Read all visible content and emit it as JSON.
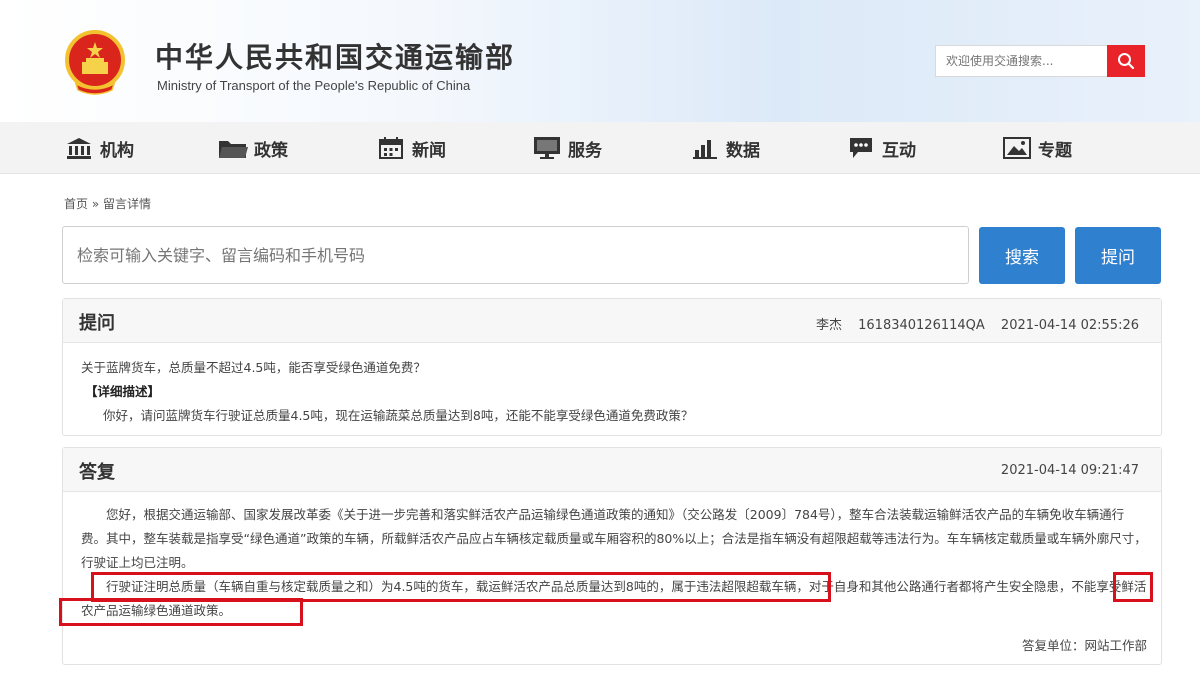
{
  "header": {
    "site_name_cn": "中华人民共和国交通运输部",
    "site_name_en": "Ministry of Transport of the People's Republic of China",
    "search_placeholder": "欢迎使用交通搜索..."
  },
  "nav": {
    "items": [
      {
        "label": "机构",
        "icon": "building-icon"
      },
      {
        "label": "政策",
        "icon": "folder-icon"
      },
      {
        "label": "新闻",
        "icon": "calendar-icon"
      },
      {
        "label": "服务",
        "icon": "monitor-icon"
      },
      {
        "label": "数据",
        "icon": "bar-chart-icon"
      },
      {
        "label": "互动",
        "icon": "chat-icon"
      },
      {
        "label": "专题",
        "icon": "image-icon"
      }
    ]
  },
  "breadcrumb": {
    "home": "首页",
    "separator": "»",
    "current": "留言详情"
  },
  "search": {
    "placeholder": "检索可输入关键字、留言编码和手机号码",
    "search_label": "搜索",
    "ask_label": "提问"
  },
  "question": {
    "title": "提问",
    "author": "李杰",
    "code": "1618340126114QA",
    "datetime": "2021-04-14 02:55:26",
    "subject": "关于蓝牌货车，总质量不超过4.5吨，能否享受绿色通道免费？",
    "detail_label": "【详细描述】",
    "detail": "你好，请问蓝牌货车行驶证总质量4.5吨，现在运输蔬菜总质量达到8吨，还能不能享受绿色通道免费政策？"
  },
  "answer": {
    "title": "答复",
    "datetime": "2021-04-14 09:21:47",
    "paragraph1": "您好，根据交通运输部、国家发展改革委《关于进一步完善和落实鲜活农产品运输绿色通道政策的通知》（交公路发〔2009〕784号），整车合法装载运输鲜活农产品的车辆免收车辆通行费。其中，整车装载是指享受“绿色通道”政策的车辆，所载鲜活农产品应占车辆核定载质量或车厢容积的80%以上；合法是指车辆没有超限超载等违法行为。车车辆核定载质量或车辆外廓尺寸，行驶证上均已注明。",
    "paragraph2": "行驶证注明总质量（车辆自重与核定载质量之和）为4.5吨的货车，载运鲜活农产品总质量达到8吨的，属于违法超限超载车辆，对于自身和其他公路通行者都将产生安全隐患，不能享受鲜活农产品运输绿色通道政策。",
    "department_label": "答复单位：",
    "department": "网站工作部"
  },
  "colors": {
    "accent_blue": "#2f80cf",
    "search_red": "#e8232a",
    "highlight_red": "#d8101c"
  }
}
